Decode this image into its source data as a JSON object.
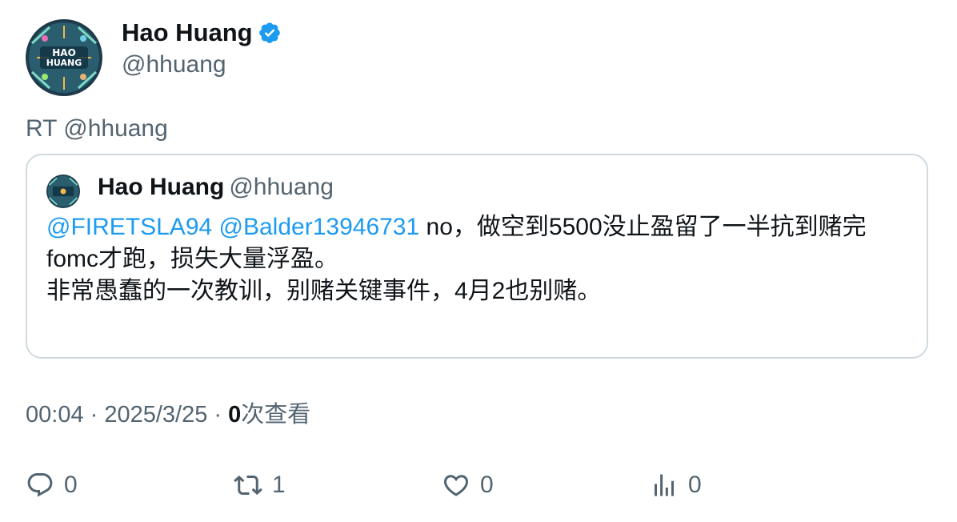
{
  "author": {
    "display_name": "Hao Huang",
    "handle": "@hhuang",
    "avatar_text": "HAO HUANG",
    "verified": true
  },
  "retweet_prefix": "RT @hhuang",
  "quoted": {
    "display_name": "Hao Huang",
    "handle": "@hhuang",
    "mention_1": "@FIRETSLA94",
    "mention_2": "@Balder13946731",
    "line_1_rest": " no，做空到5500没止盈留了一半抗到赌完fomc才跑，损失大量浮盈。",
    "line_2": "非常愚蠢的一次教训，别赌关键事件，4月2也别赌。"
  },
  "meta": {
    "time_date": "00:04 · 2025/3/25 · ",
    "views_count": "0",
    "views_label": "次查看"
  },
  "actions": {
    "reply_count": "0",
    "retweet_count": "1",
    "like_count": "0",
    "views_count": "0"
  },
  "colors": {
    "accent": "#1d9bf0",
    "text": "#0f1419",
    "muted": "#536471",
    "border": "#cfd9de"
  }
}
